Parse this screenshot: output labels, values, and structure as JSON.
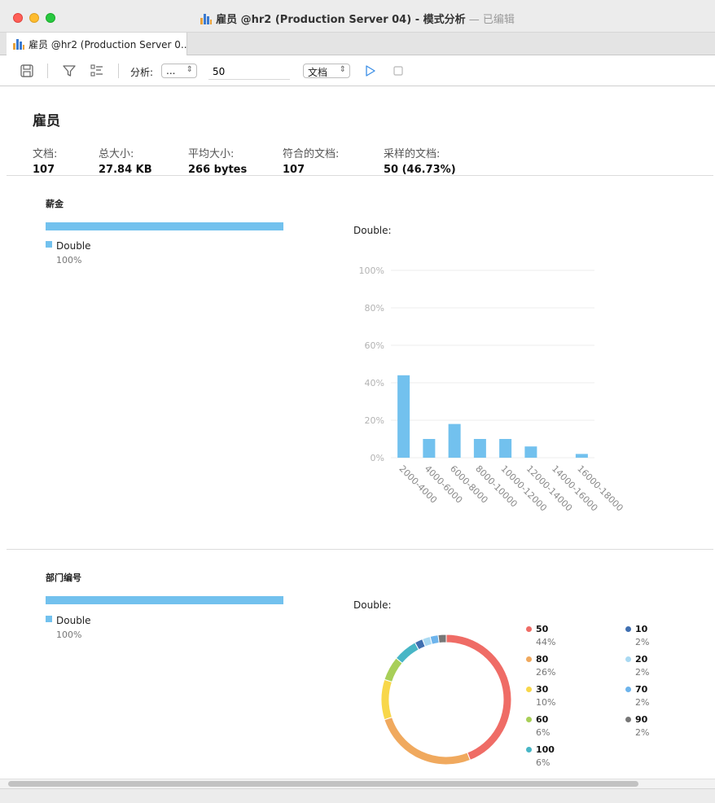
{
  "window": {
    "title_name": "雇员 @hr2 (Production Server 04) - 模式分析",
    "title_suffix": " — 已编辑",
    "tab_label": "雇员 @hr2 (Production Server 0..."
  },
  "toolbar": {
    "analyze_label": "分析:",
    "analyze_select": "...",
    "limit_value": "50",
    "mode_select": "文档"
  },
  "collection": {
    "title": "雇员",
    "stats": [
      {
        "label": "文档:",
        "value": "107"
      },
      {
        "label": "总大小:",
        "value": "27.84 KB"
      },
      {
        "label": "平均大小:",
        "value": "266 bytes"
      },
      {
        "label": "符合的文档:",
        "value": "107"
      },
      {
        "label": "采样的文档:",
        "value": "50 (46.73%)"
      }
    ]
  },
  "fields": [
    {
      "name": "薪金",
      "type": "Double",
      "type_pct": "100%",
      "chart_label": "Double:"
    },
    {
      "name": "部门编号",
      "type": "Double",
      "type_pct": "100%",
      "chart_label": "Double:"
    }
  ],
  "colors": {
    "accent": "#72c1ee"
  },
  "chart_data": [
    {
      "type": "bar",
      "title": "Double:",
      "categories": [
        "2000-4000",
        "4000-6000",
        "6000-8000",
        "8000-10000",
        "10000-12000",
        "12000-14000",
        "14000-16000",
        "16000-18000"
      ],
      "values": [
        44,
        10,
        18,
        10,
        10,
        6,
        0,
        2
      ],
      "yticks": [
        "0%",
        "20%",
        "40%",
        "60%",
        "80%",
        "100%"
      ],
      "ylim": [
        0,
        100
      ],
      "color": "#72c1ee"
    },
    {
      "type": "pie",
      "title": "Double:",
      "slices": [
        {
          "label": "50",
          "pct": "44%",
          "value": 44,
          "color": "#ef6c66"
        },
        {
          "label": "80",
          "pct": "26%",
          "value": 26,
          "color": "#f0a95e"
        },
        {
          "label": "30",
          "pct": "10%",
          "value": 10,
          "color": "#f8d74a"
        },
        {
          "label": "60",
          "pct": "6%",
          "value": 6,
          "color": "#a8cf58"
        },
        {
          "label": "100",
          "pct": "6%",
          "value": 6,
          "color": "#48b6c6"
        },
        {
          "label": "10",
          "pct": "2%",
          "value": 2,
          "color": "#3f6fb1"
        },
        {
          "label": "20",
          "pct": "2%",
          "value": 2,
          "color": "#a9d9f2"
        },
        {
          "label": "70",
          "pct": "2%",
          "value": 2,
          "color": "#6db4ec"
        },
        {
          "label": "90",
          "pct": "2%",
          "value": 2,
          "color": "#777777"
        }
      ]
    }
  ]
}
